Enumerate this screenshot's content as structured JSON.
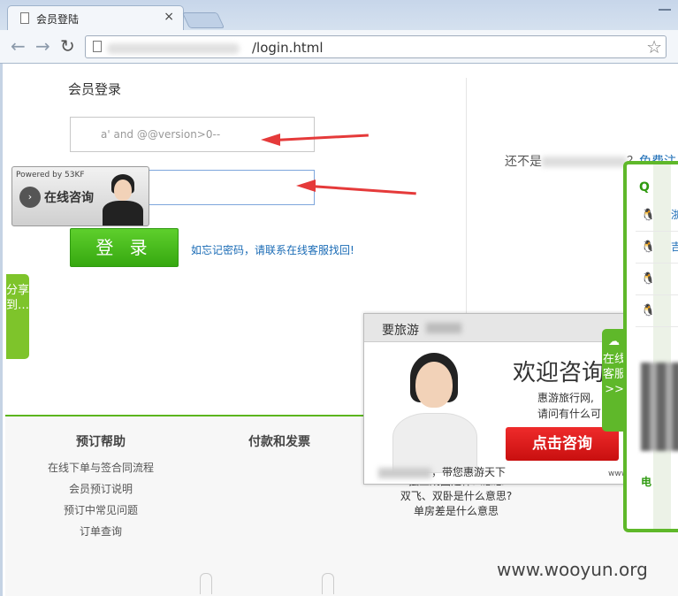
{
  "browser": {
    "tab_title": "会员登陆",
    "tab_close": "×",
    "url": "/login.html",
    "star": "☆",
    "back": "←",
    "forward": "→",
    "reload": "↻"
  },
  "login": {
    "title": "会员登录",
    "username_value": "a' and @@version>0--",
    "password_value": "",
    "submit_label": "登 录",
    "forgot_text": "如忘记密码，请联系在线客服找回!",
    "register_prefix": "还不是",
    "register_mid": "？",
    "register_link": "免费注"
  },
  "kf_widget": {
    "powered": "Powered by 53KF",
    "play": "›",
    "label": "在线咨询"
  },
  "share_tab": "分享到…",
  "footer": {
    "columns": [
      {
        "heading": "预订帮助",
        "items": [
          "在线下单与签合同流程",
          "会员预订说明",
          "预订中常见问题",
          "订单查询"
        ]
      },
      {
        "heading": "付款和发票",
        "items": []
      }
    ],
    "col3_items": [
      "独立成团是什么意思",
      "双飞、双卧是什么意思?",
      "单房差是什么意思"
    ]
  },
  "chat_popup": {
    "bar_title": "要旅游",
    "welcome": "欢迎咨询",
    "line1": "惠游旅行网,",
    "line2": "请问有什么可",
    "cta": "点击咨询",
    "slogan": "，带您惠游天下",
    "www": "www."
  },
  "service_tab": {
    "icon": "☁",
    "text": "在线客服>>"
  },
  "qq_panel": {
    "head": "Q",
    "rows": [
      {
        "icon": "🐧",
        "link": "浙"
      },
      {
        "icon": "🐧",
        "link": "吉"
      },
      {
        "icon": "🐧",
        "link": ""
      },
      {
        "icon": "🐧",
        "link": ""
      }
    ],
    "phone": "电"
  },
  "watermark": "www.wooyun.org",
  "colors": {
    "accent_green": "#5fb82a",
    "button_green": "#36a810",
    "cta_red": "#c80f0f",
    "annotation_red": "#e53a3a",
    "link_blue": "#1b6cb6"
  }
}
